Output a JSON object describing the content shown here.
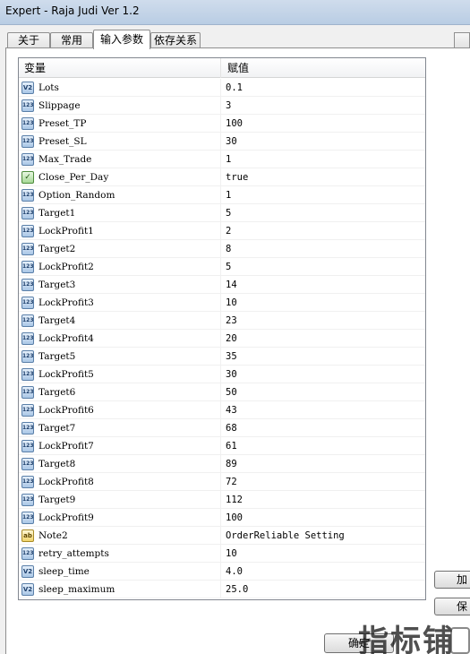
{
  "window": {
    "title": "Expert - Raja Judi Ver 1.2"
  },
  "tabs": [
    {
      "label": "关于"
    },
    {
      "label": "常用"
    },
    {
      "label": "输入参数"
    },
    {
      "label": "依存关系"
    }
  ],
  "grid": {
    "headers": {
      "variable": "变量",
      "value": "赋值"
    },
    "rows": [
      {
        "icon": "V2",
        "type": "double",
        "name": "Lots",
        "value": "0.1"
      },
      {
        "icon": "123",
        "type": "int",
        "name": "Slippage",
        "value": "3"
      },
      {
        "icon": "123",
        "type": "int",
        "name": "Preset_TP",
        "value": "100"
      },
      {
        "icon": "123",
        "type": "int",
        "name": "Preset_SL",
        "value": "30"
      },
      {
        "icon": "123",
        "type": "int",
        "name": "Max_Trade",
        "value": "1"
      },
      {
        "icon": "✓",
        "type": "bool",
        "name": "Close_Per_Day",
        "value": "true"
      },
      {
        "icon": "123",
        "type": "int",
        "name": "Option_Random",
        "value": "1"
      },
      {
        "icon": "123",
        "type": "int",
        "name": "Target1",
        "value": "5"
      },
      {
        "icon": "123",
        "type": "int",
        "name": "LockProfit1",
        "value": "2"
      },
      {
        "icon": "123",
        "type": "int",
        "name": "Target2",
        "value": "8"
      },
      {
        "icon": "123",
        "type": "int",
        "name": "LockProfit2",
        "value": "5"
      },
      {
        "icon": "123",
        "type": "int",
        "name": "Target3",
        "value": "14"
      },
      {
        "icon": "123",
        "type": "int",
        "name": "LockProfit3",
        "value": "10"
      },
      {
        "icon": "123",
        "type": "int",
        "name": "Target4",
        "value": "23"
      },
      {
        "icon": "123",
        "type": "int",
        "name": "LockProfit4",
        "value": "20"
      },
      {
        "icon": "123",
        "type": "int",
        "name": "Target5",
        "value": "35"
      },
      {
        "icon": "123",
        "type": "int",
        "name": "LockProfit5",
        "value": "30"
      },
      {
        "icon": "123",
        "type": "int",
        "name": "Target6",
        "value": "50"
      },
      {
        "icon": "123",
        "type": "int",
        "name": "LockProfit6",
        "value": "43"
      },
      {
        "icon": "123",
        "type": "int",
        "name": "Target7",
        "value": "68"
      },
      {
        "icon": "123",
        "type": "int",
        "name": "LockProfit7",
        "value": "61"
      },
      {
        "icon": "123",
        "type": "int",
        "name": "Target8",
        "value": "89"
      },
      {
        "icon": "123",
        "type": "int",
        "name": "LockProfit8",
        "value": "72"
      },
      {
        "icon": "123",
        "type": "int",
        "name": "Target9",
        "value": "112"
      },
      {
        "icon": "123",
        "type": "int",
        "name": "LockProfit9",
        "value": "100"
      },
      {
        "icon": "ab",
        "type": "string",
        "name": "Note2",
        "value": "OrderReliable Setting"
      },
      {
        "icon": "123",
        "type": "int",
        "name": "retry_attempts",
        "value": "10"
      },
      {
        "icon": "V2",
        "type": "double",
        "name": "sleep_time",
        "value": "4.0"
      },
      {
        "icon": "V2",
        "type": "double",
        "name": "sleep_maximum",
        "value": "25.0"
      }
    ]
  },
  "side_buttons": {
    "load_label": "加",
    "save_label": "保"
  },
  "footer": {
    "ok_label": "确定"
  },
  "watermark": {
    "text": "指标铺"
  }
}
